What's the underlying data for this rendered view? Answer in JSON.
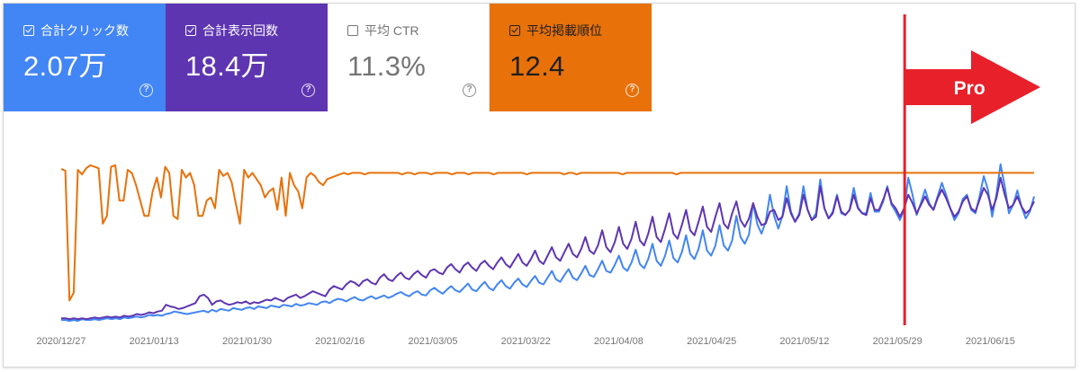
{
  "cards": [
    {
      "label": "合計クリック数",
      "value": "2.07万",
      "checked": true,
      "help": "?"
    },
    {
      "label": "合計表示回数",
      "value": "18.4万",
      "checked": true,
      "help": "?"
    },
    {
      "label": "平均 CTR",
      "value": "11.3%",
      "checked": false,
      "help": "?"
    },
    {
      "label": "平均掲載順位",
      "value": "12.4",
      "checked": true,
      "help": "?"
    }
  ],
  "colors": {
    "clicks": "#4285f4",
    "impressions": "#5e35b1",
    "ctr": "#ffffff",
    "position": "#e8710a",
    "annotation": "#e8202a"
  },
  "annotation": {
    "label": "Pro",
    "date": "2021/05/29"
  },
  "chart_data": {
    "type": "line",
    "x_ticks": [
      "2020/12/27",
      "2021/01/13",
      "2021/01/30",
      "2021/02/16",
      "2021/03/05",
      "2021/03/22",
      "2021/04/08",
      "2021/04/25",
      "2021/05/12",
      "2021/05/29",
      "2021/06/15"
    ],
    "x_start": "2020/12/27",
    "x_end": "2021/06/23",
    "grid": false,
    "legend": "none",
    "series": [
      {
        "name": "合計クリック数",
        "values": [
          2,
          2,
          1,
          2,
          1,
          3,
          2,
          2,
          3,
          2,
          3,
          4,
          3,
          4,
          3,
          5,
          4,
          5,
          6,
          5,
          6,
          8,
          7,
          8,
          7,
          9,
          10,
          12,
          11,
          10,
          9,
          10,
          11,
          12,
          13,
          11,
          14,
          12,
          15,
          14,
          13,
          16,
          15,
          14,
          16,
          17,
          15,
          18,
          17,
          16,
          19,
          18,
          17,
          20,
          19,
          18,
          21,
          19,
          20,
          22,
          21,
          20,
          23,
          24,
          22,
          25,
          27,
          26,
          24,
          27,
          29,
          26,
          25,
          28,
          30,
          27,
          29,
          31,
          28,
          30,
          33,
          35,
          32,
          30,
          34,
          36,
          32,
          31,
          37,
          40,
          36,
          33,
          38,
          42,
          37,
          35,
          40,
          45,
          38,
          36,
          42,
          47,
          40,
          37,
          44,
          49,
          42,
          39,
          46,
          51,
          44,
          41,
          48,
          54,
          46,
          44,
          52,
          60,
          50,
          47,
          55,
          62,
          52,
          49,
          57,
          66,
          55,
          53,
          62,
          72,
          60,
          58,
          67,
          78,
          64,
          60,
          70,
          85,
          68,
          63,
          74,
          92,
          72,
          66,
          78,
          96,
          75,
          70,
          82,
          102,
          80,
          74,
          86,
          108,
          84,
          78,
          90,
          114,
          90,
          84,
          96,
          125,
          100,
          92,
          103,
          140,
          115,
          104,
          118,
          150,
          125,
          110,
          125,
          160,
          130,
          118,
          128,
          160,
          132,
          120,
          128,
          168,
          134,
          122,
          130,
          150,
          128,
          126,
          132,
          158,
          135,
          128,
          128,
          152,
          130,
          130,
          142,
          160,
          138,
          130,
          120,
          132,
          170,
          150,
          126,
          140,
          156,
          140,
          132,
          148,
          164,
          150,
          134,
          120,
          128,
          145,
          150,
          132,
          128,
          148,
          172,
          156,
          124,
          150,
          186,
          160,
          128,
          138,
          155,
          136,
          122,
          130,
          148
        ]
      },
      {
        "name": "合計表示回数",
        "values": [
          4,
          4,
          3,
          4,
          3,
          4,
          3,
          4,
          5,
          4,
          5,
          6,
          5,
          6,
          5,
          7,
          6,
          7,
          9,
          8,
          9,
          11,
          10,
          12,
          13,
          20,
          18,
          17,
          15,
          16,
          18,
          20,
          22,
          30,
          32,
          28,
          20,
          24,
          25,
          22,
          20,
          21,
          23,
          22,
          24,
          21,
          23,
          22,
          24,
          26,
          25,
          28,
          26,
          24,
          28,
          30,
          32,
          28,
          30,
          33,
          36,
          34,
          32,
          30,
          38,
          42,
          40,
          38,
          44,
          48,
          46,
          42,
          48,
          50,
          46,
          44,
          52,
          56,
          50,
          48,
          54,
          58,
          52,
          50,
          56,
          60,
          55,
          52,
          60,
          62,
          58,
          56,
          64,
          68,
          62,
          58,
          66,
          70,
          64,
          60,
          68,
          72,
          66,
          62,
          70,
          76,
          68,
          64,
          72,
          80,
          70,
          66,
          74,
          84,
          72,
          68,
          78,
          88,
          76,
          72,
          82,
          92,
          80,
          76,
          86,
          100,
          84,
          80,
          90,
          108,
          88,
          82,
          94,
          112,
          92,
          86,
          98,
          118,
          96,
          90,
          104,
          124,
          100,
          94,
          110,
          128,
          104,
          98,
          114,
          132,
          108,
          102,
          118,
          136,
          112,
          106,
          124,
          140,
          116,
          110,
          128,
          142,
          120,
          112,
          122,
          140,
          124,
          114,
          116,
          130,
          132,
          120,
          124,
          146,
          128,
          118,
          126,
          150,
          132,
          120,
          124,
          160,
          134,
          122,
          128,
          148,
          130,
          126,
          132,
          150,
          134,
          128,
          126,
          146,
          132,
          132,
          144,
          158,
          140,
          134,
          124,
          134,
          150,
          140,
          128,
          138,
          148,
          138,
          132,
          146,
          156,
          146,
          134,
          124,
          130,
          142,
          148,
          134,
          130,
          144,
          158,
          150,
          132,
          146,
          170,
          150,
          134,
          138,
          148,
          136,
          128,
          132,
          142
        ]
      },
      {
        "name": "平均掲載順位",
        "values": [
          9.5,
          10.5,
          95,
          90,
          10,
          13,
          9,
          7,
          8,
          9,
          45,
          40,
          8,
          7,
          30,
          30,
          10,
          12,
          20,
          30,
          40,
          40,
          24,
          15,
          28,
          8,
          12,
          40,
          42,
          10,
          15,
          12,
          20,
          40,
          40,
          30,
          28,
          35,
          10,
          14,
          12,
          18,
          32,
          45,
          10,
          15,
          12,
          16,
          20,
          28,
          24,
          22,
          36,
          15,
          40,
          12,
          20,
          24,
          35,
          15,
          12,
          14,
          18,
          20,
          16,
          15,
          14,
          13,
          12,
          13,
          12,
          12,
          12,
          13,
          12,
          12,
          12,
          12,
          12,
          12,
          12,
          12,
          13,
          12,
          12,
          13,
          12,
          12,
          12,
          13,
          12,
          12,
          12,
          12,
          13,
          12,
          12,
          12,
          13,
          12,
          12,
          12,
          12,
          12,
          13,
          12,
          12,
          12,
          12,
          12,
          12,
          12,
          13,
          12,
          12,
          12,
          12,
          12,
          12,
          12,
          12,
          13,
          12,
          12,
          13,
          12,
          12,
          12,
          12,
          12,
          12,
          12,
          12,
          12,
          12,
          13,
          12,
          12,
          12,
          12,
          12,
          12,
          12,
          12,
          12,
          12,
          12,
          12,
          13,
          12,
          12,
          12,
          12,
          12,
          12,
          12,
          12,
          12,
          12,
          12,
          12,
          12,
          12,
          12,
          12,
          12,
          12,
          12,
          12,
          12,
          12,
          12,
          12,
          12,
          12,
          12,
          12,
          12,
          12,
          12,
          12,
          12,
          12,
          12,
          12,
          12,
          12,
          12,
          12,
          12,
          12,
          12,
          12,
          12,
          12,
          12,
          12,
          12,
          12,
          12,
          12,
          12,
          12,
          12,
          12,
          12,
          12,
          12,
          12,
          12,
          12,
          12,
          12,
          12,
          12,
          12,
          12,
          12,
          12,
          12,
          12,
          12,
          12,
          12,
          12,
          12,
          12,
          12,
          12,
          12,
          12,
          12,
          12,
          12,
          12
        ]
      }
    ]
  }
}
